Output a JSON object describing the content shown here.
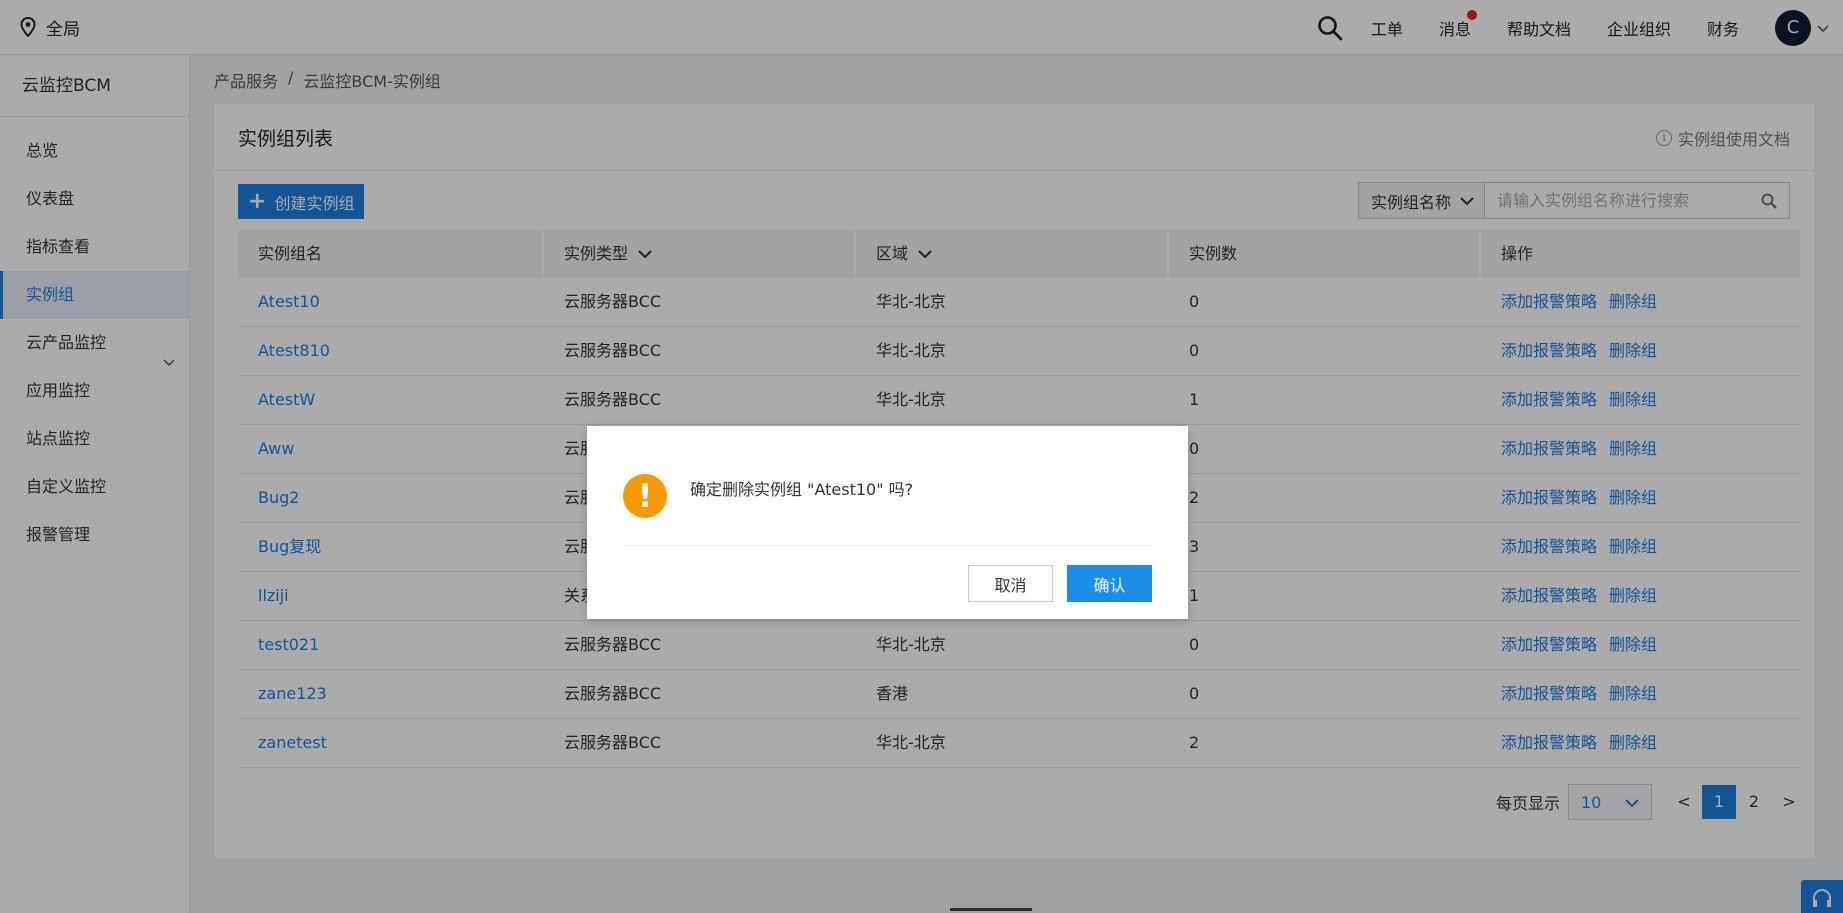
{
  "topbar": {
    "region_label": "全局",
    "nav": [
      "工单",
      "消息",
      "帮助文档",
      "企业组织",
      "财务"
    ],
    "avatar_letter": "C"
  },
  "sidebar": {
    "title": "云监控BCM",
    "items": [
      {
        "label": "总览"
      },
      {
        "label": "仪表盘"
      },
      {
        "label": "指标查看"
      },
      {
        "label": "实例组",
        "active": true
      },
      {
        "label": "云产品监控",
        "has_children": true
      },
      {
        "label": "应用监控"
      },
      {
        "label": "站点监控"
      },
      {
        "label": "自定义监控"
      },
      {
        "label": "报警管理"
      }
    ]
  },
  "breadcrumb": [
    "产品服务",
    "/",
    "云监控BCM-实例组"
  ],
  "main": {
    "title": "实例组列表",
    "doc_link": "实例组使用文档",
    "create_button": "创建实例组",
    "search": {
      "select_value": "实例组名称",
      "placeholder": "请输入实例组名称进行搜索"
    },
    "table": {
      "headers": [
        "实例组名",
        "实例类型",
        "区域",
        "实例数",
        "操作"
      ],
      "rows": [
        {
          "name": "Atest10",
          "type": "云服务器BCC",
          "region": "华北-北京",
          "count": "0"
        },
        {
          "name": "Atest810",
          "type": "云服务器BCC",
          "region": "华北-北京",
          "count": "0"
        },
        {
          "name": "AtestW",
          "type": "云服务器BCC",
          "region": "华北-北京",
          "count": "1"
        },
        {
          "name": "Aww",
          "type": "云服",
          "region": "",
          "count": "0"
        },
        {
          "name": "Bug2",
          "type": "云服",
          "region": "",
          "count": "2"
        },
        {
          "name": "Bug复现",
          "type": "云服",
          "region": "",
          "count": "3"
        },
        {
          "name": "llziji",
          "type": "关系",
          "region": "",
          "count": "1"
        },
        {
          "name": "test021",
          "type": "云服务器BCC",
          "region": "华北-北京",
          "count": "0"
        },
        {
          "name": "zane123",
          "type": "云服务器BCC",
          "region": "香港",
          "count": "0"
        },
        {
          "name": "zanetest",
          "type": "云服务器BCC",
          "region": "华北-北京",
          "count": "2"
        }
      ],
      "actions": {
        "add_alarm": "添加报警策略",
        "delete": "删除组"
      }
    },
    "pagination": {
      "per_page_label": "每页显示",
      "per_page_value": "10",
      "prev": "<",
      "pages": [
        "1",
        "2"
      ],
      "current": "1",
      "next": ">"
    }
  },
  "dialog": {
    "message": "确定删除实例组 \"Atest10\" 吗?",
    "cancel": "取消",
    "confirm": "确认"
  },
  "colors": {
    "primary": "#1b7ee0",
    "warning": "#f59b00",
    "avatar_bg": "#0f1d33",
    "badge": "#e02020"
  }
}
